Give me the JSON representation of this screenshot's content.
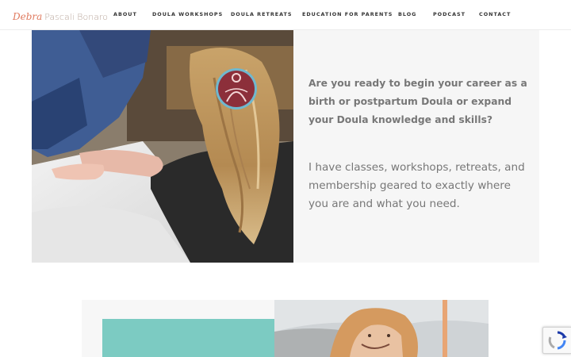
{
  "brand": {
    "first": "Debra",
    "rest": "Pascali Bonaro"
  },
  "nav": [
    "ABOUT",
    "DOULA WORKSHOPS",
    "DOULA RETREATS",
    "EDUCATION FOR PARENTS",
    "BLOG",
    "PODCAST",
    "CONTACT"
  ],
  "hero": {
    "question": "Are you ready to begin your career as a birth or postpartum Doula or expand your Doula knowledge and skills?",
    "body": "I have classes, workshops, retreats, and membership geared to exactly where you are and what you need."
  },
  "colors": {
    "accent_teal": "#7ccbc2",
    "logo_coral": "#e07a5f",
    "medallion": "#8c2f3a",
    "text_gray": "#777777"
  },
  "icons": [
    "recaptcha-icon"
  ]
}
